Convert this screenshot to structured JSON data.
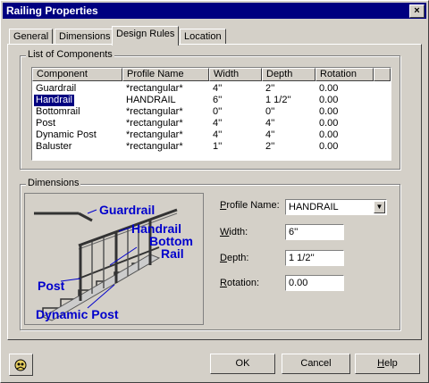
{
  "window": {
    "title": "Railing Properties",
    "close_glyph": "×"
  },
  "tabs": [
    {
      "label": "General"
    },
    {
      "label": "Dimensions"
    },
    {
      "label": "Design Rules"
    },
    {
      "label": "Location"
    }
  ],
  "list": {
    "group_label": "List of Components",
    "columns": [
      "Component",
      "Profile Name",
      "Width",
      "Depth",
      "Rotation"
    ],
    "rows": [
      {
        "component": "Guardrail",
        "profile": "*rectangular*",
        "width": "4''",
        "depth": "2''",
        "rotation": "0.00"
      },
      {
        "component": "Handrail",
        "profile": "HANDRAIL",
        "width": "6''",
        "depth": "1 1/2''",
        "rotation": "0.00",
        "selected": true
      },
      {
        "component": "Bottomrail",
        "profile": "*rectangular*",
        "width": "0''",
        "depth": "0''",
        "rotation": "0.00"
      },
      {
        "component": "Post",
        "profile": "*rectangular*",
        "width": "4''",
        "depth": "4''",
        "rotation": "0.00"
      },
      {
        "component": "Dynamic Post",
        "profile": "*rectangular*",
        "width": "4''",
        "depth": "4''",
        "rotation": "0.00"
      },
      {
        "component": "Baluster",
        "profile": "*rectangular*",
        "width": "1''",
        "depth": "2''",
        "rotation": "0.00"
      }
    ]
  },
  "dimensions": {
    "group_label": "Dimensions",
    "diagram_labels": {
      "guardrail": "Guardrail",
      "handrail": "Handrail",
      "bottom": "Bottom",
      "rail": "Rail",
      "post": "Post",
      "dynamic_post": "Dynamic Post"
    },
    "profile_name": {
      "label_u": "P",
      "label_rest": "rofile Name:",
      "value": "HANDRAIL"
    },
    "width": {
      "label_u": "W",
      "label_rest": "idth:",
      "value": "6''"
    },
    "depth": {
      "label_u": "D",
      "label_rest": "epth:",
      "value": "1 1/2''"
    },
    "rotation": {
      "label_u": "R",
      "label_rest": "otation:",
      "value": "0.00"
    }
  },
  "buttons": {
    "ok": "OK",
    "cancel": "Cancel",
    "help_u": "H",
    "help_rest": "elp"
  },
  "colors": {
    "titlebar": "#000080",
    "diagram_text": "#0000cc",
    "selection": "#000080"
  },
  "icons": [
    "close-icon",
    "combo-arrow-icon",
    "help-icon"
  ]
}
